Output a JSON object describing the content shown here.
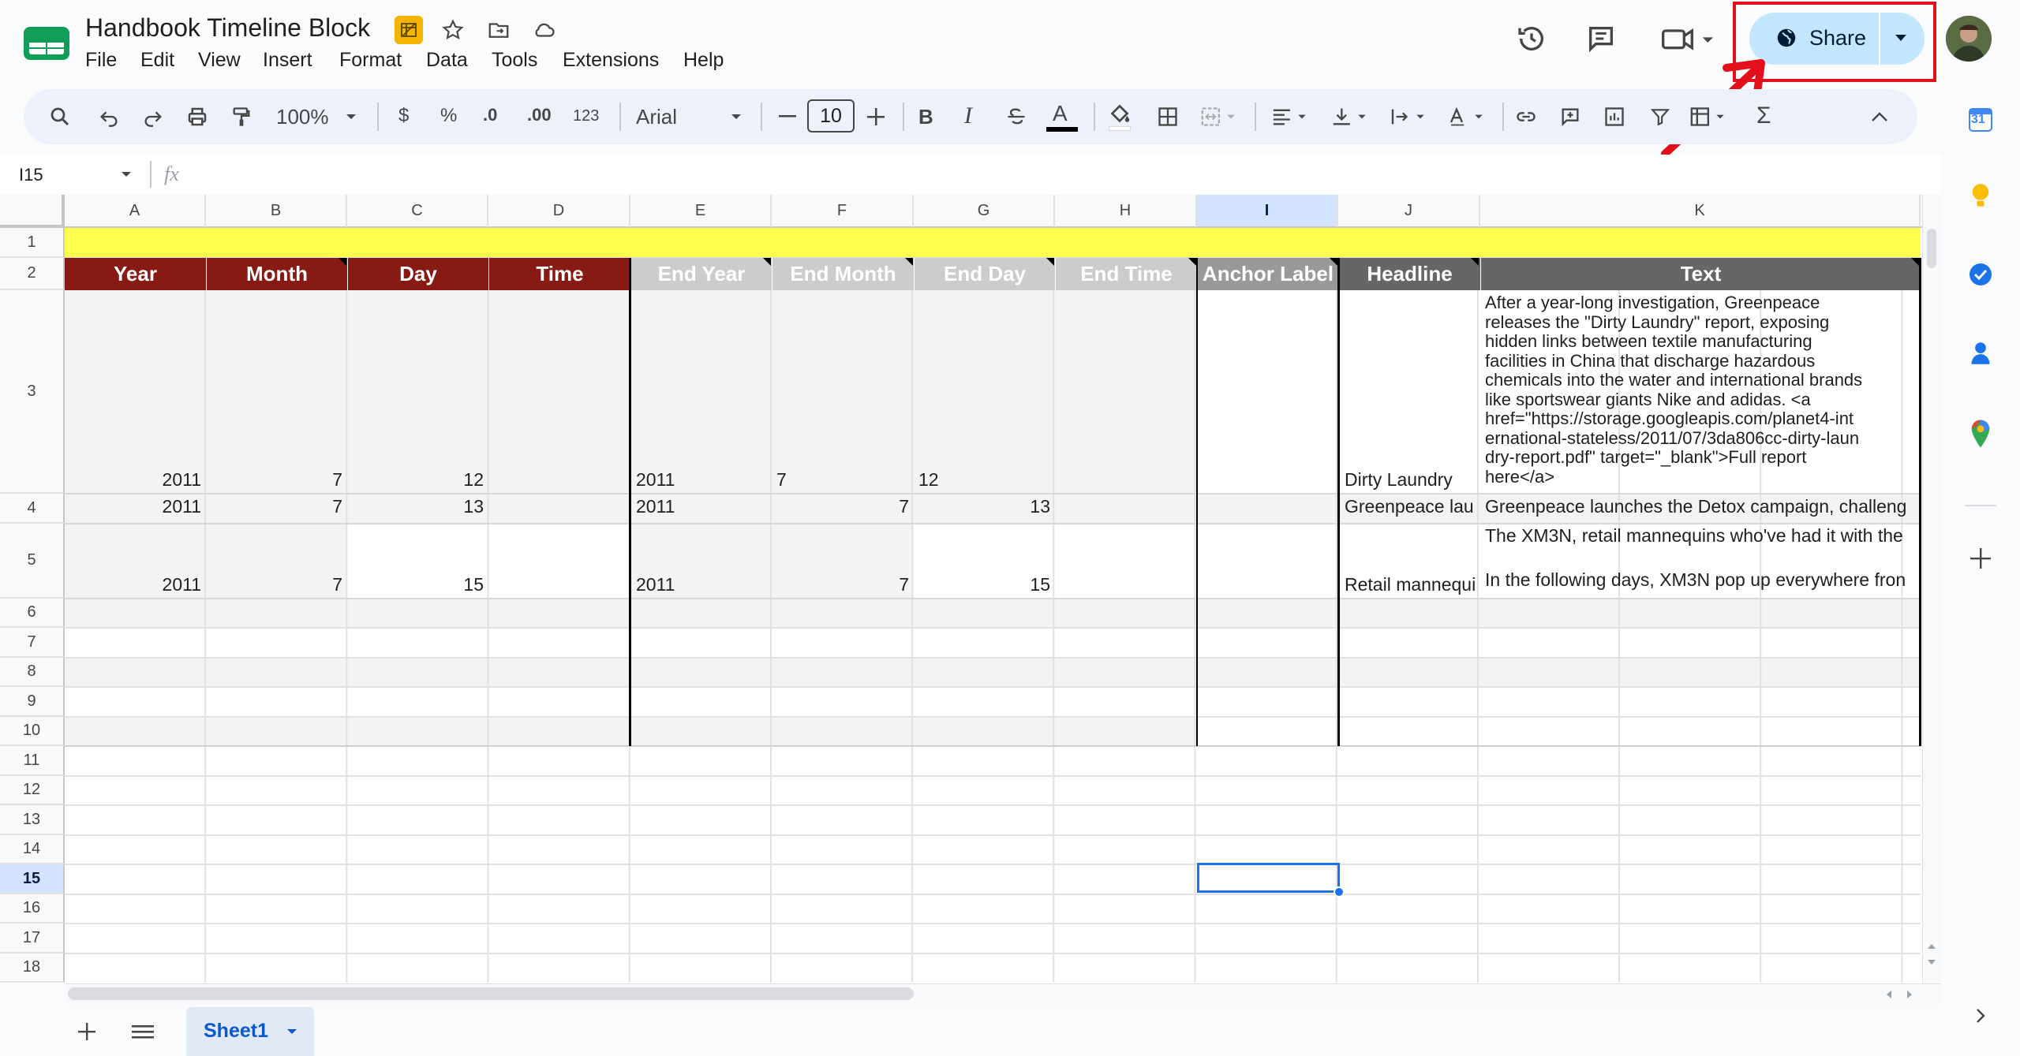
{
  "app": {
    "title": "Handbook Timeline Block",
    "menu": [
      "File",
      "Edit",
      "View",
      "Insert",
      "Format",
      "Data",
      "Tools",
      "Extensions",
      "Help"
    ],
    "share_label": "Share",
    "brand_color": "#0f9d58",
    "share_bg": "#c2e7ff",
    "highlight_color": "#e3101c"
  },
  "toolbar": {
    "zoom": "100%",
    "currency": "$",
    "percent": "%",
    "decrease_decimal": ".0",
    "increase_decimal": ".00",
    "number_format": "123",
    "font": "Arial",
    "font_size": "10",
    "bold": "B",
    "italic": "I",
    "text_color_letter": "A",
    "sum": "Σ"
  },
  "formula_bar": {
    "name_box": "I15",
    "fx": "fx",
    "value": ""
  },
  "columns": [
    "A",
    "B",
    "C",
    "D",
    "E",
    "F",
    "G",
    "H",
    "I",
    "J",
    "K"
  ],
  "selected_column": "I",
  "rows": [
    "1",
    "2",
    "3",
    "4",
    "5",
    "6",
    "7",
    "8",
    "9",
    "10",
    "11",
    "12",
    "13",
    "14",
    "15",
    "16",
    "17",
    "18"
  ],
  "selected_row": "15",
  "header_row": {
    "year": "Year",
    "month": "Month",
    "day": "Day",
    "time": "Time",
    "end_year": "End Year",
    "end_month": "End Month",
    "end_day": "End Day",
    "end_time": "End Time",
    "anchor_label": "Anchor Label",
    "headline": "Headline",
    "text": "Text"
  },
  "header_colors": {
    "dark_red": "#871a12",
    "light_gray": "#cccccc",
    "mid_gray": "#999999",
    "dark_gray": "#666666",
    "yellow": "#ffff4d"
  },
  "data_rows": [
    {
      "year": "2011",
      "month": "7",
      "day": "12",
      "time": "",
      "end_year": "2011",
      "end_month": "7",
      "end_day": "12",
      "end_time": "",
      "anchor_label": "",
      "headline": "Dirty Laundry",
      "text": "After a year-long investigation, Greenpeace\nreleases the \"Dirty Laundry\" report, exposing\nhidden links between textile manufacturing\nfacilities in China that discharge hazardous\nchemicals into the water and international brands\nlike sportswear giants Nike and adidas. <a\nhref=\"https://storage.googleapis.com/planet4-int\nernational-stateless/2011/07/3da806cc-dirty-laun\ndry-report.pdf\" target=\"_blank\">Full report\nhere</a>"
    },
    {
      "year": "2011",
      "month": "7",
      "day": "13",
      "time": "",
      "end_year": "2011",
      "end_month": "7",
      "end_day": "13",
      "end_time": "",
      "anchor_label": "",
      "headline": "Greenpeace lau",
      "text": "Greenpeace launches the Detox campaign, challeng"
    },
    {
      "year": "2011",
      "month": "7",
      "day": "15",
      "time": "",
      "end_year": "2011",
      "end_month": "7",
      "end_day": "15",
      "end_time": "",
      "anchor_label": "",
      "headline": "Retail mannequi",
      "text_line1": "The XM3N, retail mannequins who've had it with the",
      "text_line2": "In the following days, XM3N pop up everywhere fron"
    }
  ],
  "sheet_tabs": [
    "Sheet1"
  ],
  "side_panel": [
    "calendar-icon",
    "keep-icon",
    "tasks-icon",
    "contacts-icon",
    "maps-icon"
  ],
  "calendar_day": "31"
}
